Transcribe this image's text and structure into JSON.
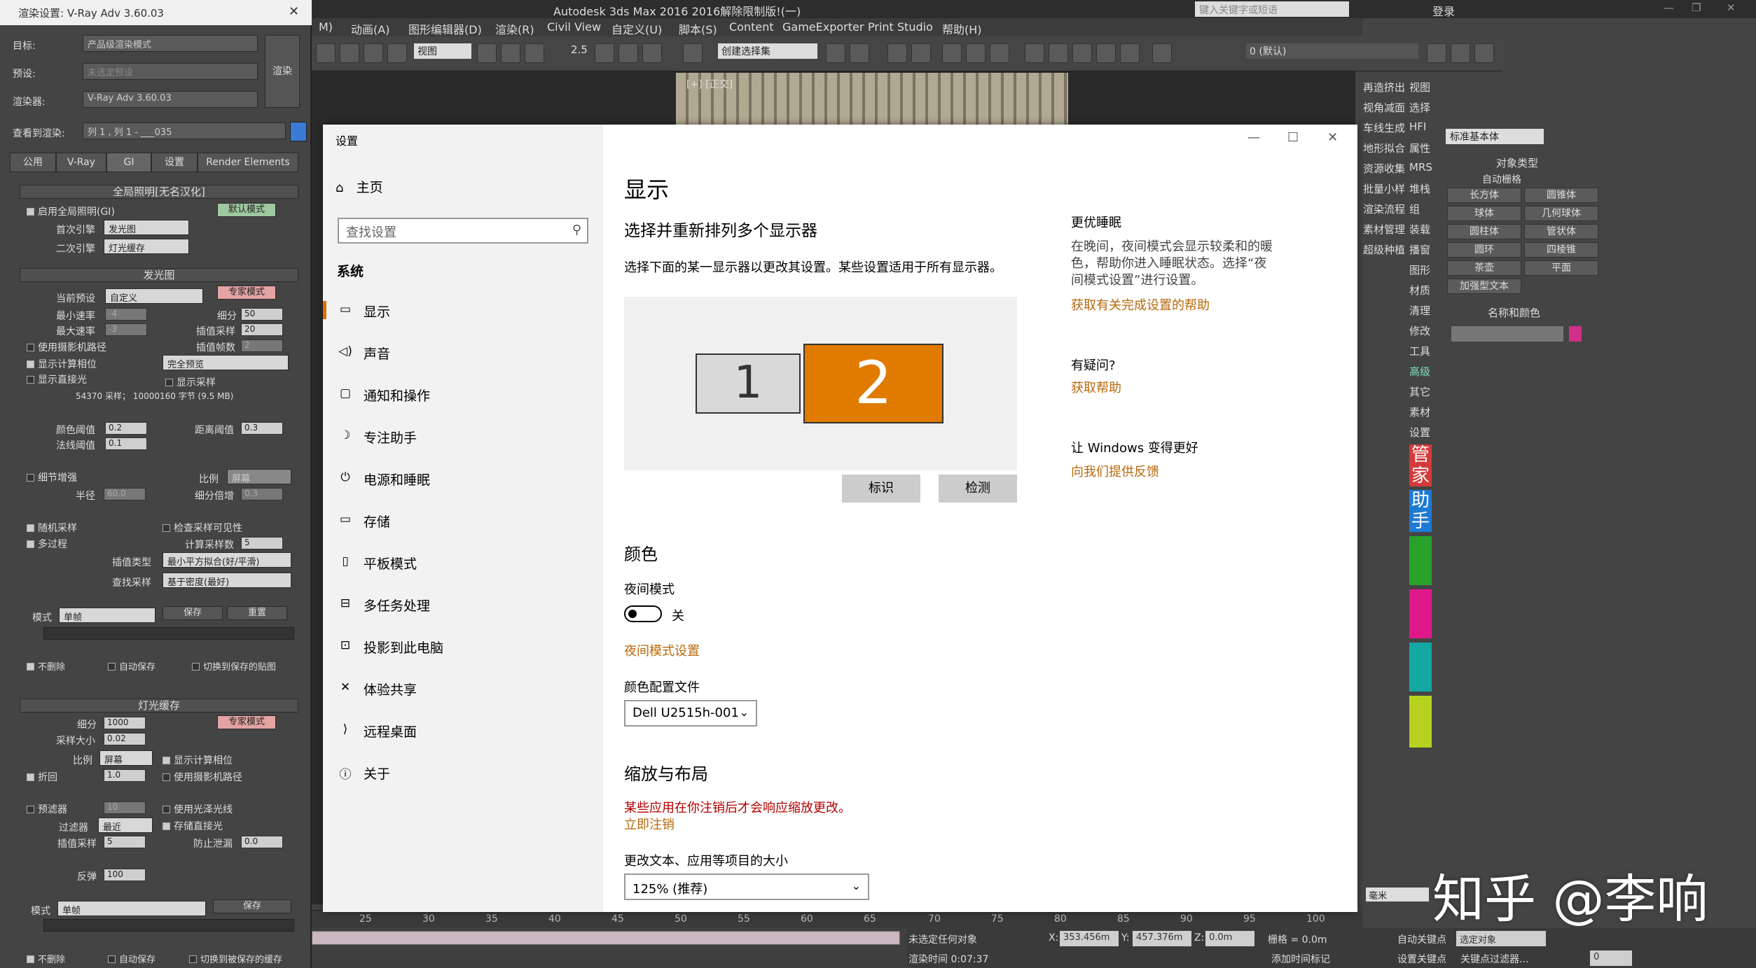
{
  "max": {
    "title": "Autodesk 3ds Max 2016      2016解除限制版!(一)",
    "search_placeholder": "键入关键字或短语",
    "login": "登录",
    "menus": [
      "M)",
      "动画(A)",
      "图形编辑器(D)",
      "渲染(R)",
      "Civil View",
      "自定义(U)",
      "脚本(S)",
      "Content",
      "GameExporter",
      "Print Studio",
      "帮助(H)"
    ],
    "toolbar_view": "视图",
    "toolbar_selset": "创建选择集",
    "toolbar_layer": "0 (默认)",
    "toolbar_numbers": "2.5",
    "viewport_label": "[+] [正交]",
    "ruler_ticks": [
      "25",
      "30",
      "35",
      "40",
      "45",
      "50",
      "55",
      "60",
      "65",
      "70",
      "75",
      "80",
      "85",
      "90",
      "95",
      "100"
    ],
    "status": {
      "no_selection": "未选定任何对象",
      "x_label": "X:",
      "x_value": "353.456m",
      "y_label": "Y:",
      "y_value": "457.376m",
      "z_label": "Z:",
      "z_value": "0.0m",
      "grid": "栅格 = 0.0m",
      "render_time": "渲染时间 0:07:37",
      "add_time_tag": "添加时间标记",
      "auto_key": "自动关键点",
      "selected_objects": "选定对象",
      "set_key": "设置关键点",
      "key_filter": "关键点过滤器...",
      "frame": "0"
    },
    "unit": "毫米"
  },
  "command_panel": {
    "left_col": [
      "再造挤出",
      "视角减面",
      "车线生成",
      "地形拟合",
      "资源收集",
      "批量小样",
      "渲染流程",
      "素材管理",
      "超级种植"
    ],
    "right_col": [
      "视图",
      "选择",
      "HFI",
      "属性",
      "MRS",
      "堆栈",
      "组",
      "装载",
      "播窗",
      "图形",
      "材质",
      "清理",
      "修改",
      "工具",
      "高级",
      "其它",
      "素材",
      "设置"
    ],
    "dropdown": "标准基本体",
    "object_type_title": "对象类型",
    "autogrid": "自动栅格",
    "primitives": [
      [
        "长方体",
        "圆锥体"
      ],
      [
        "球体",
        "几何球体"
      ],
      [
        "圆柱体",
        "管状体"
      ],
      [
        "圆环",
        "四棱锥"
      ],
      [
        "茶壶",
        "平面"
      ]
    ],
    "extended": "加强型文本",
    "name_color_title": "名称和颜色",
    "side_buttons": [
      "管家",
      "助手"
    ]
  },
  "vray": {
    "title": "渲染设置: V-Ray Adv 3.60.03",
    "target_label": "目标:",
    "target_value": "产品级渲染模式",
    "preset_label": "预设:",
    "preset_value": "未选定预设",
    "renderer_label": "渲染器:",
    "renderer_value": "V-Ray Adv 3.60.03",
    "view_label": "查看到渲染:",
    "view_value": "列 1 , 列 1 - ___035",
    "render_button": "渲染",
    "tabs": [
      "公用",
      "V-Ray",
      "GI",
      "设置",
      "Render Elements"
    ],
    "gi": {
      "title": "全局照明[无名汉化]",
      "enable": "启用全局照明(GI)",
      "default_mode": "默认模式",
      "primary_label": "首次引擎",
      "primary_value": "发光图",
      "secondary_label": "二次引擎",
      "secondary_value": "灯光缓存"
    },
    "irradiance": {
      "title": "发光图",
      "preset_label": "当前预设",
      "preset_value": "自定义",
      "expert_mode": "专家模式",
      "min_rate_label": "最小速率",
      "min_rate": "-4",
      "max_rate_label": "最大速率",
      "max_rate": "-3",
      "subdiv_label": "细分",
      "subdiv": "50",
      "interp_label": "插值采样",
      "interp": "20",
      "interp_frames_label": "插值帧数",
      "interp_frames": "2",
      "camera_path": "使用摄影机路径",
      "show_calc": "显示计算相位",
      "show_calc_value": "完全预览",
      "show_direct": "显示直接光",
      "show_samples": "显示采样",
      "stats": "54370 采样； 10000160 字节 (9.5 MB)",
      "color_thresh_label": "颜色阈值",
      "color_thresh": "0.2",
      "dist_thresh_label": "距离阈值",
      "dist_thresh": "0.3",
      "normal_thresh_label": "法线阈值",
      "normal_thresh": "0.1",
      "detail": "细节增强",
      "scale_label": "比例",
      "scale_value": "屏幕",
      "radius_label": "半径",
      "radius": "60.0",
      "subdiv_mult_label": "细分倍增",
      "subdiv_mult": "0.3",
      "random": "随机采样",
      "check_vis": "检查采样可见性",
      "multipass": "多过程",
      "calc_samples_label": "计算采样数",
      "calc_samples": "5",
      "interp_type_label": "插值类型",
      "interp_type": "最小平方拟合(好/平滑)",
      "lookup_label": "查找采样",
      "lookup": "基于密度(最好)",
      "mode_label": "模式",
      "mode": "单帧",
      "save": "保存",
      "reset": "重置",
      "no_delete": "不删除",
      "auto_save": "自动保存",
      "switch_saved": "切换到保存的贴图"
    },
    "lightcache": {
      "title": "灯光缓存",
      "expert_mode": "专家模式",
      "subdiv_label": "细分",
      "subdiv": "1000",
      "sample_size_label": "采样大小",
      "sample_size": "0.02",
      "scale_label": "比例",
      "scale": "屏幕",
      "show_calc": "显示计算相位",
      "retrace": "折回",
      "retrace_value": "1.0",
      "camera_path": "使用摄影机路径",
      "prefilter": "预滤器",
      "prefilter_value": "10",
      "gloss_rays": "使用光泽光线",
      "filter_label": "过滤器",
      "filter_value": "最近",
      "store_direct": "存储直接光",
      "interp_label": "插值采样",
      "interp_value": "5",
      "leak_label": "防止泄漏",
      "leak_value": "0.0",
      "bounces_label": "反弹",
      "bounces": "100",
      "mode_label": "模式",
      "mode": "单帧",
      "save": "保存",
      "no_delete": "不删除",
      "auto_save": "自动保存",
      "switch_saved": "切换到被保存的缓存"
    }
  },
  "settings": {
    "window_title": "设置",
    "home": "主页",
    "search_placeholder": "查找设置",
    "section": "系统",
    "nav": [
      {
        "icon": "▭",
        "label": "显示"
      },
      {
        "icon": "◁)",
        "label": "声音"
      },
      {
        "icon": "▢",
        "label": "通知和操作"
      },
      {
        "icon": "☽",
        "label": "专注助手"
      },
      {
        "icon": "⏻",
        "label": "电源和睡眠"
      },
      {
        "icon": "▭",
        "label": "存储"
      },
      {
        "icon": "▯",
        "label": "平板模式"
      },
      {
        "icon": "⊟",
        "label": "多任务处理"
      },
      {
        "icon": "⊡",
        "label": "投影到此电脑"
      },
      {
        "icon": "✕",
        "label": "体验共享"
      },
      {
        "icon": "⟩",
        "label": "远程桌面"
      },
      {
        "icon": "ⓘ",
        "label": "关于"
      }
    ],
    "page_title": "显示",
    "arrange_title": "选择并重新排列多个显示器",
    "arrange_desc": "选择下面的某一显示器以更改其设置。某些设置适用于所有显示器。",
    "monitor1": "1",
    "monitor2": "2",
    "identify": "标识",
    "detect": "检测",
    "color_title": "颜色",
    "night_mode": "夜间模式",
    "night_state": "关",
    "night_settings": "夜间模式设置",
    "color_profile_label": "颜色配置文件",
    "color_profile": "Dell U2515h-001",
    "scale_title": "缩放与布局",
    "scale_warning": "某些应用在你注销后才会响应缩放更改。",
    "sign_out": "立即注销",
    "text_size_label": "更改文本、应用等项目的大小",
    "text_size": "125% (推荐)",
    "sleep_title": "更优睡眠",
    "sleep_desc1": "在晚间，夜间模式会显示较柔和的暖",
    "sleep_desc2": "色，帮助你进入睡眠状态。选择“夜",
    "sleep_desc3": "间模式设置”进行设置。",
    "sleep_link": "获取有关完成设置的帮助",
    "question_title": "有疑问?",
    "help_link": "获取帮助",
    "better_title": "让 Windows 变得更好",
    "feedback_link": "向我们提供反馈"
  },
  "watermark": "知乎 @李响",
  "colors": {
    "accent": "#e07b00",
    "link": "#b8680b",
    "warn": "#b00000"
  }
}
